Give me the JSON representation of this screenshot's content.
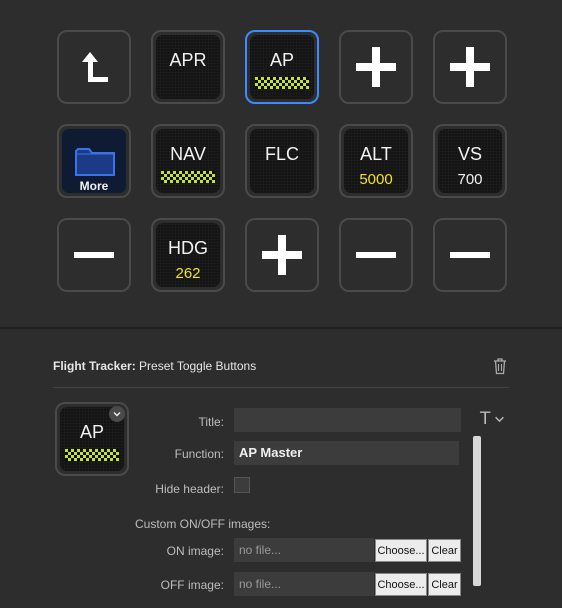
{
  "grid": {
    "row1": {
      "back": {
        "icon": "back-arrow-icon"
      },
      "apr": {
        "label": "APR"
      },
      "ap": {
        "label": "AP"
      },
      "plus1": {
        "icon": "plus-icon"
      },
      "plus2": {
        "icon": "plus-icon"
      }
    },
    "row2": {
      "folder": {
        "label": "More",
        "icon": "folder-icon"
      },
      "nav": {
        "label": "NAV"
      },
      "flc": {
        "label": "FLC"
      },
      "alt": {
        "label": "ALT",
        "value": "5000"
      },
      "vs": {
        "label": "VS",
        "value": "700"
      }
    },
    "row3": {
      "minus1": {
        "icon": "minus-icon"
      },
      "hdg": {
        "label": "HDG",
        "value": "262"
      },
      "plus3": {
        "icon": "plus-icon"
      },
      "minus2": {
        "icon": "minus-icon"
      },
      "minus3": {
        "icon": "minus-icon"
      }
    }
  },
  "panel": {
    "plugin_name": "Flight Tracker:",
    "action_name": "Preset Toggle Buttons",
    "preview_label": "AP",
    "fields": {
      "title_label": "Title:",
      "title_value": "",
      "function_label": "Function:",
      "function_value": "AP Master",
      "hide_header_label": "Hide header:",
      "custom_images_label": "Custom ON/OFF images:",
      "on_image_label": "ON image:",
      "on_image_value": "no file...",
      "off_image_label": "OFF image:",
      "off_image_value": "no file...",
      "choose_label": "Choose...",
      "clear_label": "Clear"
    }
  },
  "colors": {
    "accent_blue": "#3a8bff",
    "value_yellow": "#f2e02a",
    "indicator_green": "#c6e22a"
  }
}
